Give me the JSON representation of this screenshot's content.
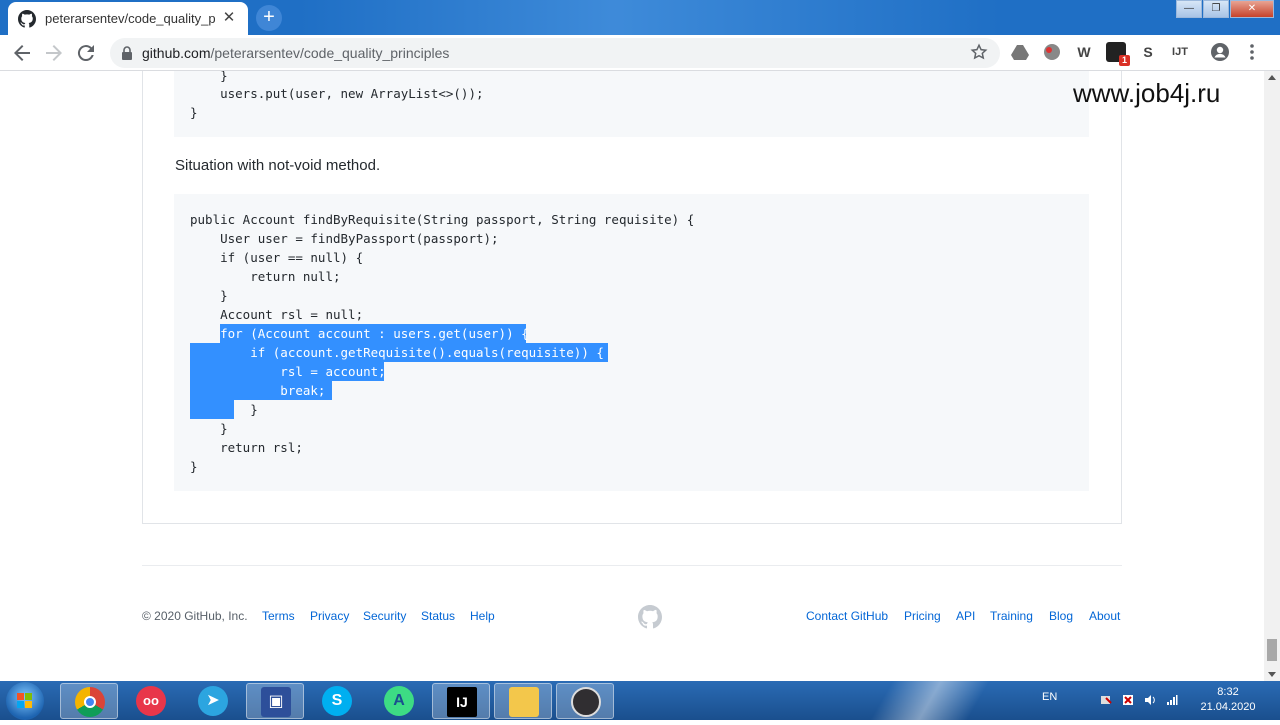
{
  "browser": {
    "tab_title": "peterarsentev/code_quality_princ",
    "tab_close": "✕",
    "new_tab": "+",
    "window_controls": {
      "minimize": "—",
      "maximize": "❐",
      "close": "✕"
    },
    "address": {
      "host": "github.com",
      "path": "/peterarsentev/code_quality_principles"
    },
    "extensions": [
      "W",
      "S",
      "IJT"
    ],
    "extension_badge": "1"
  },
  "watermark": "www.job4j.ru",
  "readme": {
    "code_block_1": [
      "    }",
      "    users.put(user, new ArrayList<>());",
      "}"
    ],
    "situation_text": "Situation with not-void method.",
    "code_block_2": [
      "public Account findByRequisite(String passport, String requisite) {",
      "    User user = findByPassport(passport);",
      "    if (user == null) {",
      "        return null;",
      "    }",
      "    Account rsl = null;",
      "    for (Account account : users.get(user)) {",
      "        if (account.getRequisite().equals(requisite)) {",
      "            rsl = account;",
      "            break;",
      "        }",
      "    }",
      "    return rsl;",
      "}"
    ]
  },
  "footer": {
    "copyright": "© 2020 GitHub, Inc.",
    "left_links": [
      "Terms",
      "Privacy",
      "Security",
      "Status",
      "Help"
    ],
    "right_links": [
      "Contact GitHub",
      "Pricing",
      "API",
      "Training",
      "Blog",
      "About"
    ]
  },
  "taskbar": {
    "apps": [
      "chrome",
      "ooo",
      "telegram",
      "disk",
      "skype",
      "android",
      "intellij",
      "explorer",
      "obs"
    ],
    "tray_lang": "EN",
    "time": "8:32",
    "date": "21.04.2020"
  },
  "colors": {
    "selection": "#3390ff",
    "link": "#0366d6",
    "code_bg": "#f6f8fa",
    "titlebar": "#1f6fc5",
    "taskbar": "#1a4f8e"
  }
}
